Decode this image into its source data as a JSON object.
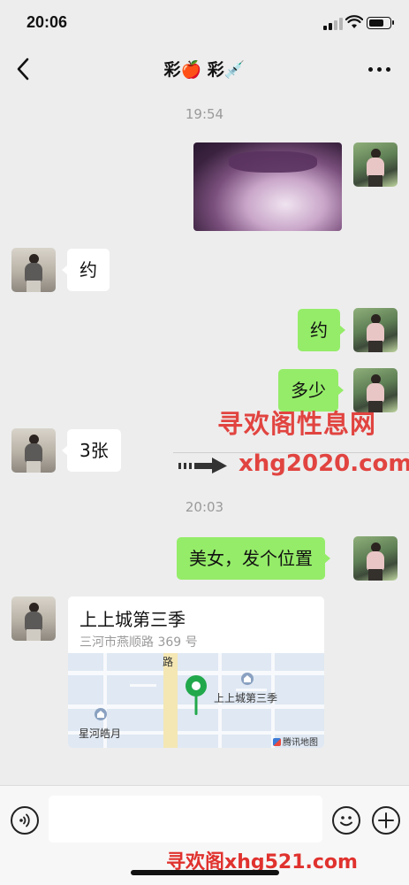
{
  "status_bar": {
    "time": "20:06",
    "signal_bars": 2,
    "battery_level": 0.6
  },
  "header": {
    "title": "彩🍎 彩💉"
  },
  "messages": {
    "ts1": "19:54",
    "m2": "约",
    "m3": "约",
    "m4": "多少",
    "m5": "3张",
    "ts2": "20:03",
    "m6": "美女，发个位置"
  },
  "location": {
    "title": "上上城第三季",
    "address": "三河市燕顺路 369 号",
    "map_pin_label": "上上城第三季",
    "map_poi_label": "星河皓月",
    "map_road_label": "路",
    "map_provider": "腾讯地图"
  },
  "watermarks": {
    "cn_name": "寻欢阁性息网",
    "domain": "xhg2020.com",
    "footer": "寻欢阁xhg521.com"
  },
  "input": {
    "placeholder": ""
  },
  "colors": {
    "my_bubble": "#95ec69",
    "their_bubble": "#ffffff",
    "background": "#ededed",
    "pin": "#21a84b",
    "watermark": "#e0322e"
  }
}
